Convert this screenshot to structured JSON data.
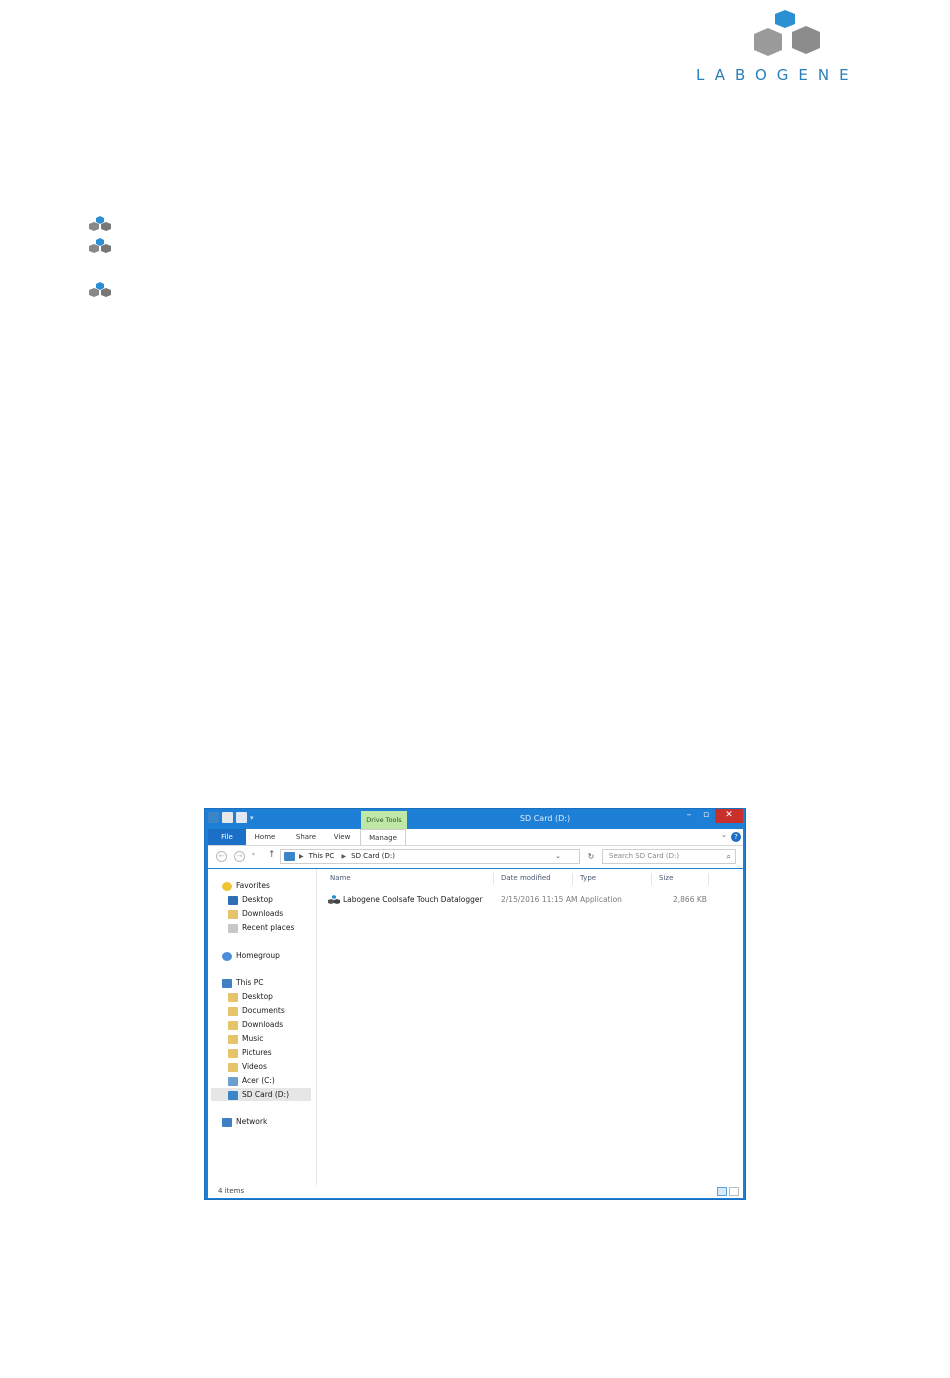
{
  "brand": {
    "name": "LABOGENE"
  },
  "explorer": {
    "window_title": "SD Card (D:)",
    "contextual_tab": "Drive Tools",
    "ribbon_tabs": [
      "File",
      "Home",
      "Share",
      "View",
      "Manage"
    ],
    "help_glyph": "?",
    "address": {
      "crumbs": [
        "This PC",
        "SD Card (D:)"
      ]
    },
    "search": {
      "placeholder": "Search SD Card (D:)"
    },
    "nav_pane": {
      "favorites": {
        "label": "Favorites",
        "items": [
          "Desktop",
          "Downloads",
          "Recent places"
        ]
      },
      "homegroup": "Homegroup",
      "this_pc": {
        "label": "This PC",
        "items": [
          "Desktop",
          "Documents",
          "Downloads",
          "Music",
          "Pictures",
          "Videos",
          "Acer (C:)",
          "SD Card (D:)"
        ]
      },
      "network": "Network"
    },
    "columns": [
      "Name",
      "Date modified",
      "Type",
      "Size"
    ],
    "files": [
      {
        "name": "Labogene Coolsafe Touch Datalogger",
        "date_modified": "2/15/2016 11:15 AM",
        "type": "Application",
        "size": "2,866 KB"
      }
    ],
    "status": {
      "items_count": "4 items"
    },
    "icons": [
      "sd-card-icon",
      "star-icon",
      "folder-icon",
      "homegroup-icon",
      "computer-icon",
      "network-icon",
      "application-icon",
      "search-icon",
      "refresh-icon"
    ],
    "colors": {
      "title_bar": "#1e7fd6",
      "file_tab": "#1c6fc6",
      "drive_tools": "#bfe8a7",
      "close": "#c9302c"
    }
  }
}
